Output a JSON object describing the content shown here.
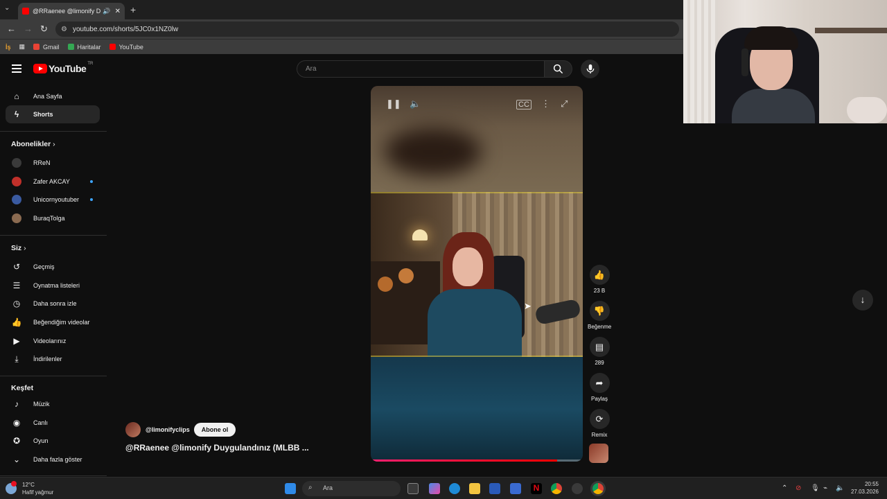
{
  "browser": {
    "tab_title": "@RRaenee @limonify Duyg",
    "url": "youtube.com/shorts/5JC0x1NZ0lw",
    "bookmarks": [
      {
        "label": "Gmail",
        "color": "#ea4335"
      },
      {
        "label": "Haritalar",
        "color": "#34a853"
      },
      {
        "label": "YouTube",
        "color": "#ff0000"
      }
    ]
  },
  "youtube": {
    "logo_text": "YouTube",
    "region": "TR",
    "search_placeholder": "Ara"
  },
  "sidebar": {
    "main": [
      {
        "label": "Ana Sayfa",
        "icon": "home-icon"
      },
      {
        "label": "Shorts",
        "icon": "shorts-icon",
        "active": true
      }
    ],
    "subscriptions_header": "Abonelikler",
    "subscriptions": [
      {
        "label": "RReN",
        "color": "#3a3a3a",
        "new": false
      },
      {
        "label": "Zafer AKCAY",
        "color": "#c0302a",
        "new": true
      },
      {
        "label": "Unicornyoutuber",
        "color": "#3a5aa0",
        "new": true
      },
      {
        "label": "BuraqTolga",
        "color": "#8a6a50",
        "new": false
      }
    ],
    "you_header": "Siz",
    "you": [
      {
        "label": "Geçmiş",
        "icon": "history-icon"
      },
      {
        "label": "Oynatma listeleri",
        "icon": "playlist-icon"
      },
      {
        "label": "Daha sonra izle",
        "icon": "clock-icon"
      },
      {
        "label": "Beğendiğim videolar",
        "icon": "thumb-up-icon"
      },
      {
        "label": "Videolarınız",
        "icon": "video-icon"
      },
      {
        "label": "İndirilenler",
        "icon": "download-icon"
      }
    ],
    "explore_header": "Keşfet",
    "explore": [
      {
        "label": "Müzik",
        "icon": "music-icon"
      },
      {
        "label": "Canlı",
        "icon": "live-icon"
      },
      {
        "label": "Oyun",
        "icon": "game-icon"
      },
      {
        "label": "Daha fazla göster",
        "icon": "chevron-down-icon"
      }
    ]
  },
  "short": {
    "channel": "@limonifyclips",
    "subscribe_label": "Abone ol",
    "title": "@RRaenee @limonify Duygulandınız (MLBB ...",
    "progress": 0.88
  },
  "actions": {
    "like_count": "23 B",
    "dislike_label": "Beğenme",
    "comment_count": "289",
    "share_label": "Paylaş",
    "remix_label": "Remix"
  },
  "taskbar": {
    "temp": "12°C",
    "weather": "Hafif yağmur",
    "search_label": "Ara",
    "time": "20:55",
    "date": "27.03.2026"
  }
}
